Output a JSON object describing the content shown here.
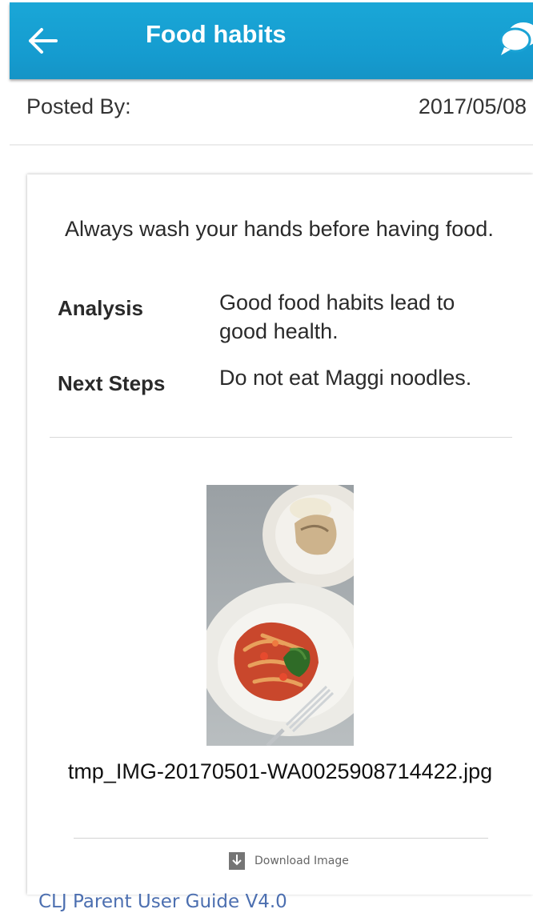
{
  "header": {
    "title": "Food habits",
    "back_icon": "arrow-left-icon",
    "chat_icon": "chat-bubbles-icon",
    "color": "#169fd2"
  },
  "post": {
    "posted_by_label": "Posted By:",
    "date": "2017/05/08"
  },
  "card": {
    "description": "Always wash your hands before having food.",
    "analysis_label": "Analysis",
    "analysis_value": "Good food habits lead to good health.",
    "next_steps_label": "Next Steps",
    "next_steps_value": "Do not eat Maggi noodles.",
    "attachment": {
      "filename": "tmp_IMG-20170501-WA0025908714422.jpg",
      "download_label": "Download Image",
      "download_icon": "download-icon"
    }
  },
  "footer": {
    "text": "CLJ Parent User Guide V4.0",
    "color": "#4c6fb0"
  }
}
